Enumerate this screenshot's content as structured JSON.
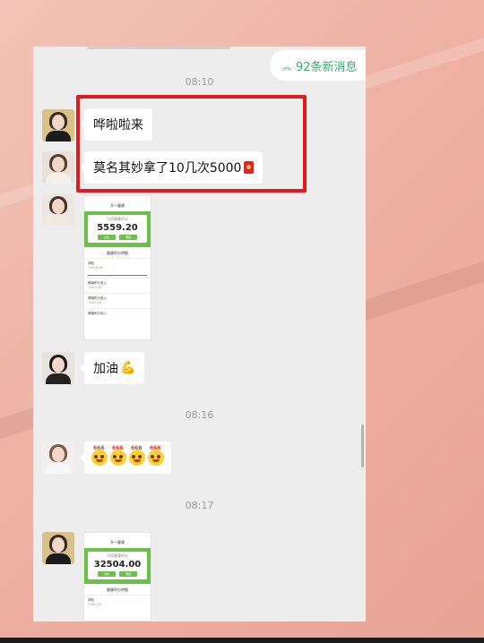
{
  "new_messages": {
    "label": "92条新消息",
    "icon": "double-chevron-up-icon"
  },
  "timestamps": [
    "08:10",
    "08:16",
    "08:17"
  ],
  "messages": [
    {
      "type": "text",
      "text": "哗啦啦来",
      "avatar": "avatar-woman-1"
    },
    {
      "type": "text",
      "text": "莫名其妙拿了10几次5000",
      "sticker": "red-envelope-icon",
      "avatar": "avatar-woman-2"
    },
    {
      "type": "image",
      "avatar": "avatar-woman-3",
      "screenshot": {
        "nav_title": "开一健康",
        "card_caption": "可用健康积分",
        "amount": "5559.20",
        "buttons": [
          "兑换",
          "明细"
        ],
        "subhead": "健康积分明细",
        "rows": [
          {
            "label": "获取",
            "value": "+5000.00"
          },
          {
            "label": "健康积分收入",
            "value": "+500.00"
          },
          {
            "label": "健康积分收入",
            "value": "+500.00"
          },
          {
            "label": "健康积分收入",
            "value": ""
          }
        ]
      }
    },
    {
      "type": "text",
      "text": "加油",
      "sticker": "flexed-biceps-icon",
      "avatar": "avatar-woman-4"
    },
    {
      "type": "emoji",
      "avatar": "avatar-woman-5",
      "emojis": [
        "666",
        "666",
        "666",
        "666"
      ]
    },
    {
      "type": "image",
      "avatar": "avatar-woman-1",
      "screenshot": {
        "nav_title": "开一健康",
        "card_caption": "可用健康积分",
        "amount": "32504.00",
        "buttons": [
          "兑换",
          "明细"
        ],
        "subhead": "健康积分明细",
        "rows": [
          {
            "label": "获取",
            "value": "+500.00"
          }
        ]
      }
    }
  ],
  "colors": {
    "accent_green": "#2bb46a",
    "highlight_red": "#e21a1a",
    "chat_bg": "#ededed",
    "app_green": "#6cc04a"
  }
}
